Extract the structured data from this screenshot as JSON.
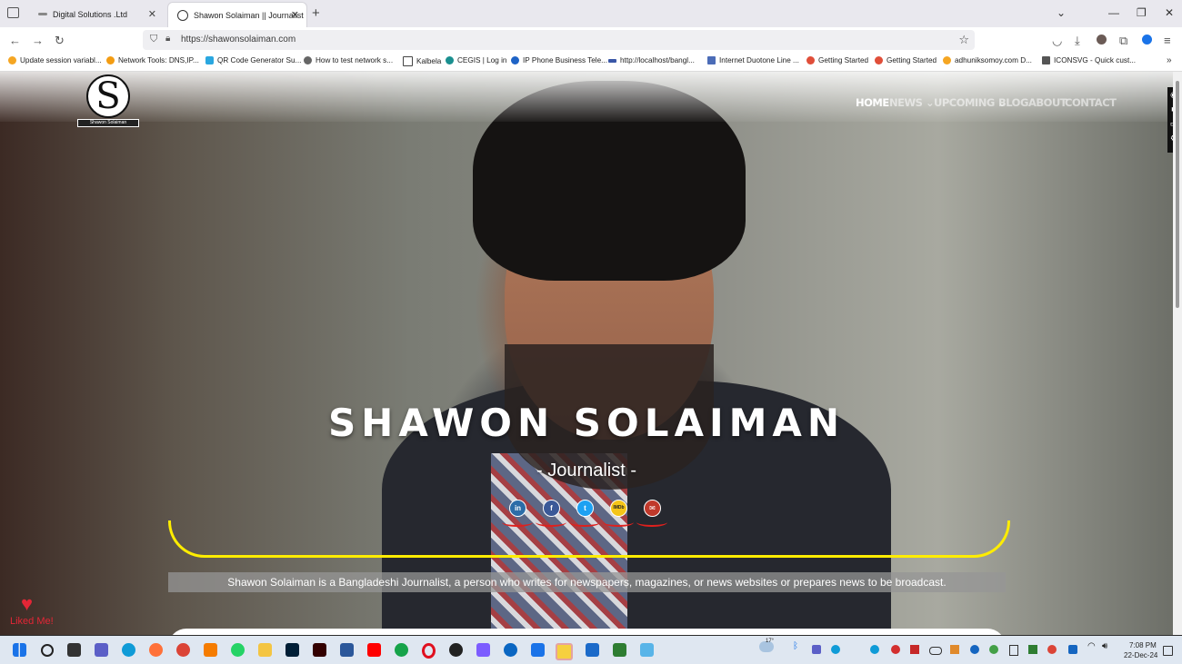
{
  "browser": {
    "tabs": [
      {
        "title": "Digital Solutions .Ltd",
        "close": "✕"
      },
      {
        "title": "Shawon Solaiman || Journalist",
        "close": "✕"
      }
    ],
    "new_tab": "+",
    "url": "https://shawonsolaiman.com",
    "bookmarks": [
      "Update session variabl...",
      "Network Tools: DNS,IP...",
      "QR Code Generator Su...",
      "How to test network s...",
      "Kalbela",
      "CEGIS | Log in",
      "IP Phone Business Tele...",
      "http://localhost/bangl...",
      "Internet Duotone Line ...",
      "Getting Started",
      "Getting Started",
      "adhuniksomoy.com D...",
      "ICONSVG - Quick cust..."
    ],
    "bookmark_colors": [
      "#f5a623",
      "#f39c12",
      "#2aa7e0",
      "#666666",
      "#8a6d3b",
      "#1a8f8f",
      "#1e63c6",
      "#3a57a7",
      "#4b6cb7",
      "#e04e39",
      "#e04e39",
      "#f5a623",
      "#555555"
    ]
  },
  "site": {
    "logo_letter": "S",
    "logo_caption": "Shawon Solaiman",
    "menu": [
      "HOME",
      "NEWS ⌄",
      "UPCOMING ⌄",
      "BLOG",
      "ABOUT",
      "CONTACT"
    ],
    "name": "SHAWON SOLAIMAN",
    "role": "- Journalist -",
    "social": [
      {
        "label": "in",
        "color": "#2c6da8",
        "icon": "linkedin-icon"
      },
      {
        "label": "f",
        "color": "#3b5998",
        "icon": "facebook-icon"
      },
      {
        "label": "t",
        "color": "#1da1f2",
        "icon": "twitter-icon"
      },
      {
        "label": "IMDb",
        "color": "#f5c518",
        "icon": "imdb-icon"
      },
      {
        "label": "✉",
        "color": "#c0392b",
        "icon": "email-icon"
      }
    ],
    "description": "Shawon Solaiman is a Bangladeshi Journalist, a person who writes for newspapers, magazines, or news websites or prepares news to be broadcast.",
    "liked_label": "Liked Me!",
    "heart": "♥"
  },
  "taskbar": {
    "weather": "17°",
    "time": "7:08 PM",
    "date": "22-Dec-24"
  }
}
